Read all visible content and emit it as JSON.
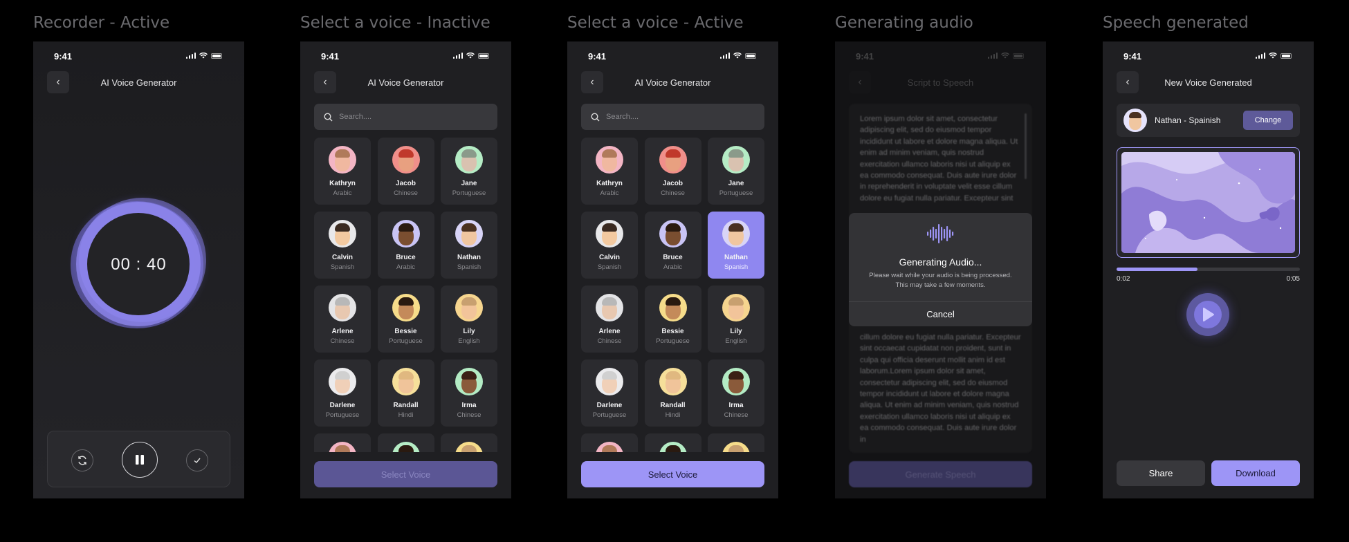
{
  "labels": [
    "Recorder - Active",
    "Select a voice - Inactive",
    "Select a voice - Active",
    "Generating audio",
    "Speech generated"
  ],
  "status_time": "9:41",
  "screens": {
    "recorder": {
      "title": "AI Voice Generator",
      "timer": "00 : 40"
    },
    "voice_inactive": {
      "title": "AI Voice Generator",
      "search_placeholder": "Search....",
      "button": "Select Voice"
    },
    "voice_active": {
      "title": "AI Voice Generator",
      "search_placeholder": "Search....",
      "button": "Select Voice",
      "selected": "Nathan"
    },
    "generating": {
      "title": "Script to Speech",
      "script_top": "Lorem ipsum dolor sit amet, consectetur adipiscing elit, sed do eiusmod tempor incididunt ut labore et dolore magna aliqua. Ut enim ad minim veniam, quis nostrud exercitation ullamco laboris nisi ut aliquip ex ea commodo consequat. Duis aute irure dolor in reprehenderit in voluptate velit esse cillum dolore eu fugiat nulla pariatur. Excepteur sint",
      "script_bottom": "cillum dolore eu fugiat nulla pariatur. Excepteur sint occaecat cupidatat non proident, sunt in culpa qui officia deserunt mollit anim id est laborum.Lorem ipsum dolor sit amet, consectetur adipiscing elit, sed do eiusmod tempor incididunt ut labore et dolore magna aliqua. Ut enim ad minim veniam, quis nostrud exercitation ullamco laboris nisi ut aliquip ex ea commodo consequat. Duis aute irure dolor in",
      "modal_title": "Generating Audio...",
      "modal_text_1": "Please wait while your audio is being processed.",
      "modal_text_2": "This may take a few moments.",
      "cancel": "Cancel",
      "button": "Generate Speech"
    },
    "speech": {
      "title": "New Voice Generated",
      "voice": "Nathan - Spainish",
      "change": "Change",
      "elapsed": "0:02",
      "duration": "0:05",
      "progress_fraction": 0.44,
      "share": "Share",
      "download": "Download"
    }
  },
  "voices": [
    {
      "name": "Kathryn",
      "lang": "Arabic",
      "bg": "#f3b5c4",
      "skin": "#f0b8a0",
      "hair": "#b07a5a"
    },
    {
      "name": "Jacob",
      "lang": "Chinese",
      "bg": "#f08f8a",
      "skin": "#e8a080",
      "hair": "#c0392b"
    },
    {
      "name": "Jane",
      "lang": "Portuguese",
      "bg": "#b5ecc5",
      "skin": "#d9c2b0",
      "hair": "#8a9a8a"
    },
    {
      "name": "Calvin",
      "lang": "Spanish",
      "bg": "#e8e8ea",
      "skin": "#f2c9a0",
      "hair": "#3a2a20"
    },
    {
      "name": "Bruce",
      "lang": "Arabic",
      "bg": "#c9c4f5",
      "skin": "#7a4e30",
      "hair": "#2a1a10"
    },
    {
      "name": "Nathan",
      "lang": "Spanish",
      "bg": "#d8d4f7",
      "skin": "#f0c6a0",
      "hair": "#4a3020"
    },
    {
      "name": "Arlene",
      "lang": "Chinese",
      "bg": "#e4e4e6",
      "skin": "#e8c8b0",
      "hair": "#b8b8b8"
    },
    {
      "name": "Bessie",
      "lang": "Portuguese",
      "bg": "#f6dc8a",
      "skin": "#c48a5a",
      "hair": "#2a1a10"
    },
    {
      "name": "Lily",
      "lang": "English",
      "bg": "#f6d58f",
      "skin": "#f2c49a",
      "hair": "#c8a070"
    },
    {
      "name": "Darlene",
      "lang": "Portuguese",
      "bg": "#ebebed",
      "skin": "#f0d0b8",
      "hair": "#d0d0d0"
    },
    {
      "name": "Randall",
      "lang": "Hindi",
      "bg": "#f6df9a",
      "skin": "#f0c49a",
      "hair": "#e0b880"
    },
    {
      "name": "Irma",
      "lang": "Chinese",
      "bg": "#b3ebc4",
      "skin": "#8a5a3a",
      "hair": "#3a2015"
    },
    {
      "name": "",
      "lang": "",
      "bg": "#f3b5c4",
      "skin": "#f0b8a0",
      "hair": "#b07a5a"
    },
    {
      "name": "",
      "lang": "",
      "bg": "#b5ecc5",
      "skin": "#7a5a40",
      "hair": "#2a1a10"
    },
    {
      "name": "",
      "lang": "",
      "bg": "#f6dc8a",
      "skin": "#f2c49a",
      "hair": "#c8a070"
    }
  ],
  "colors": {
    "accent": "#9d95f6",
    "accent_dim": "#5f5a99",
    "card": "#2b2b2f",
    "bg": "#1f1f22"
  }
}
